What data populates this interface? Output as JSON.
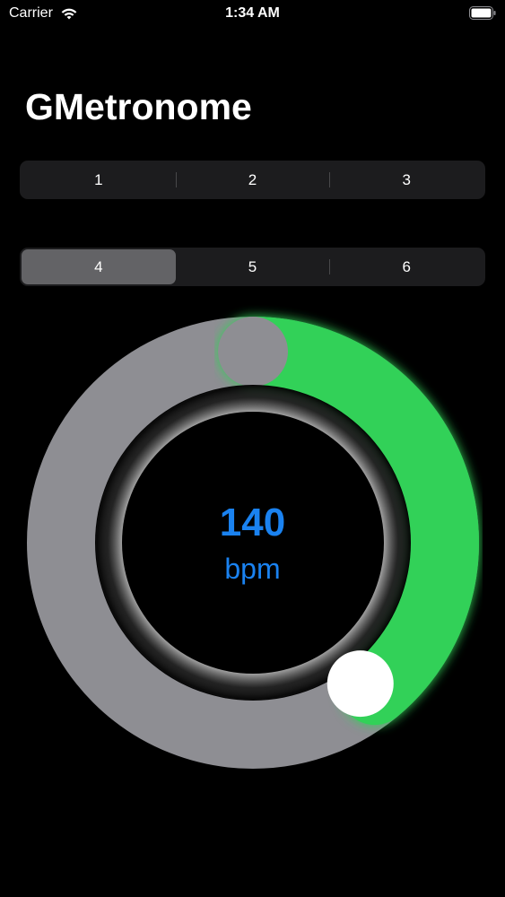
{
  "status_bar": {
    "carrier": "Carrier",
    "time": "1:34 AM",
    "wifi_icon": "wifi-icon",
    "battery_icon": "battery-icon"
  },
  "app": {
    "title": "GMetronome"
  },
  "beats_control_top": {
    "segments": [
      {
        "label": "1",
        "selected": false
      },
      {
        "label": "2",
        "selected": false
      },
      {
        "label": "3",
        "selected": false
      }
    ]
  },
  "beats_control_bottom": {
    "segments": [
      {
        "label": "4",
        "selected": true
      },
      {
        "label": "5",
        "selected": false
      },
      {
        "label": "6",
        "selected": false
      }
    ]
  },
  "tempo_dial": {
    "value": "140",
    "unit": "bpm",
    "progress_fraction": 0.39,
    "colors": {
      "track": "#8e8e93",
      "progress": "#30d158",
      "value_text": "#1a82f0",
      "knob": "#ffffff"
    }
  }
}
